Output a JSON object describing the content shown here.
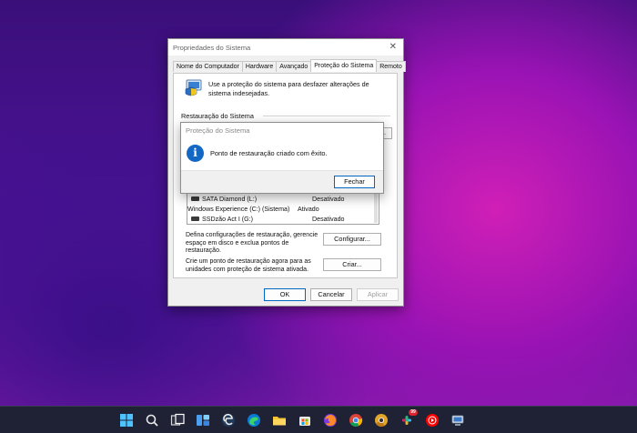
{
  "window": {
    "title": "Propriedades do Sistema",
    "tabs": [
      {
        "label": "Nome do Computador"
      },
      {
        "label": "Hardware"
      },
      {
        "label": "Avançado"
      },
      {
        "label": "Proteção do Sistema"
      },
      {
        "label": "Remoto"
      }
    ],
    "intro": "Use a proteção do sistema para desfazer alterações de sistema indesejadas.",
    "restore_group": "Restauração do Sistema",
    "drives": [
      {
        "name": "SATA Diamond (L:)",
        "status": "Desativado"
      },
      {
        "name": "Windows Experience  (C:) (Sistema)",
        "status": "Ativado"
      },
      {
        "name": "SSDzão Act I (G:)",
        "status": "Desativado"
      }
    ],
    "configure_desc": "Defina configurações de restauração, gerencie espaço em disco e exclua pontos de restauração.",
    "configure_button": "Configurar...",
    "create_desc": "Crie um ponto de restauração agora para as unidades com proteção de sistema ativada.",
    "create_button": "Criar...",
    "ok_button": "OK",
    "cancel_button": "Cancelar",
    "apply_button": "Aplicar"
  },
  "message": {
    "title": "Proteção do Sistema",
    "text": "Ponto de restauração criado com êxito.",
    "close_button": "Fechar"
  },
  "taskbar": {
    "background": "#1f2235",
    "items": [
      {
        "icon": "windows-start-icon"
      },
      {
        "icon": "search-icon"
      },
      {
        "icon": "task-view-icon"
      },
      {
        "icon": "widgets-icon"
      },
      {
        "icon": "edge-dev-icon"
      },
      {
        "icon": "edge-icon"
      },
      {
        "icon": "file-explorer-icon"
      },
      {
        "icon": "store-icon"
      },
      {
        "icon": "firefox-icon"
      },
      {
        "icon": "chrome-icon"
      },
      {
        "icon": "chrome-canary-icon"
      },
      {
        "icon": "slack-icon",
        "badge": "99"
      },
      {
        "icon": "youtube-music-icon"
      },
      {
        "icon": "network-monitor-icon"
      }
    ]
  }
}
